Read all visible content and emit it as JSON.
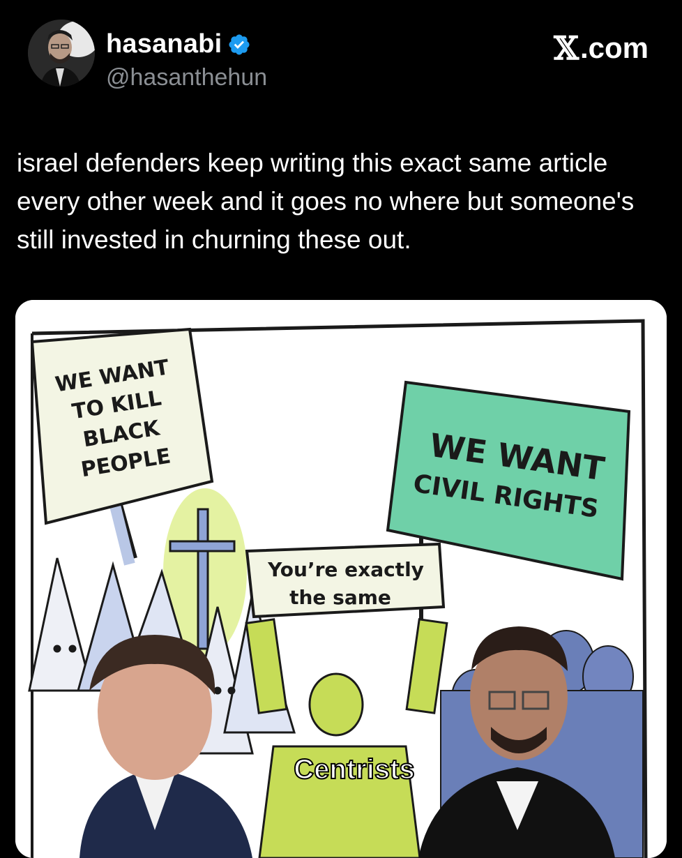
{
  "user": {
    "display_name": "hasanabi",
    "handle": "@hasanthehun",
    "verified": true,
    "verified_icon_color": "#1d9bf0"
  },
  "site_label": ".com",
  "site_logo": "x-logo-icon",
  "tweet": {
    "text": "israel defenders keep writing this exact same article every other week and it goes no where but someone's still invested in churning these out."
  },
  "meme": {
    "left_sign": [
      "WE WANT",
      "TO KILL",
      "BLACK",
      "PEOPLE"
    ],
    "right_sign": [
      "WE WANT",
      "CIVIL RIGHTS"
    ],
    "center_sign": [
      "You’re exactly",
      "the same"
    ],
    "caption": "Centrists",
    "colors": {
      "right_sign": "#6fd0a8",
      "center_figure": "#c6dc57",
      "right_crowd": "#6a7fb8",
      "left_sign": "#f3f5e4"
    }
  }
}
